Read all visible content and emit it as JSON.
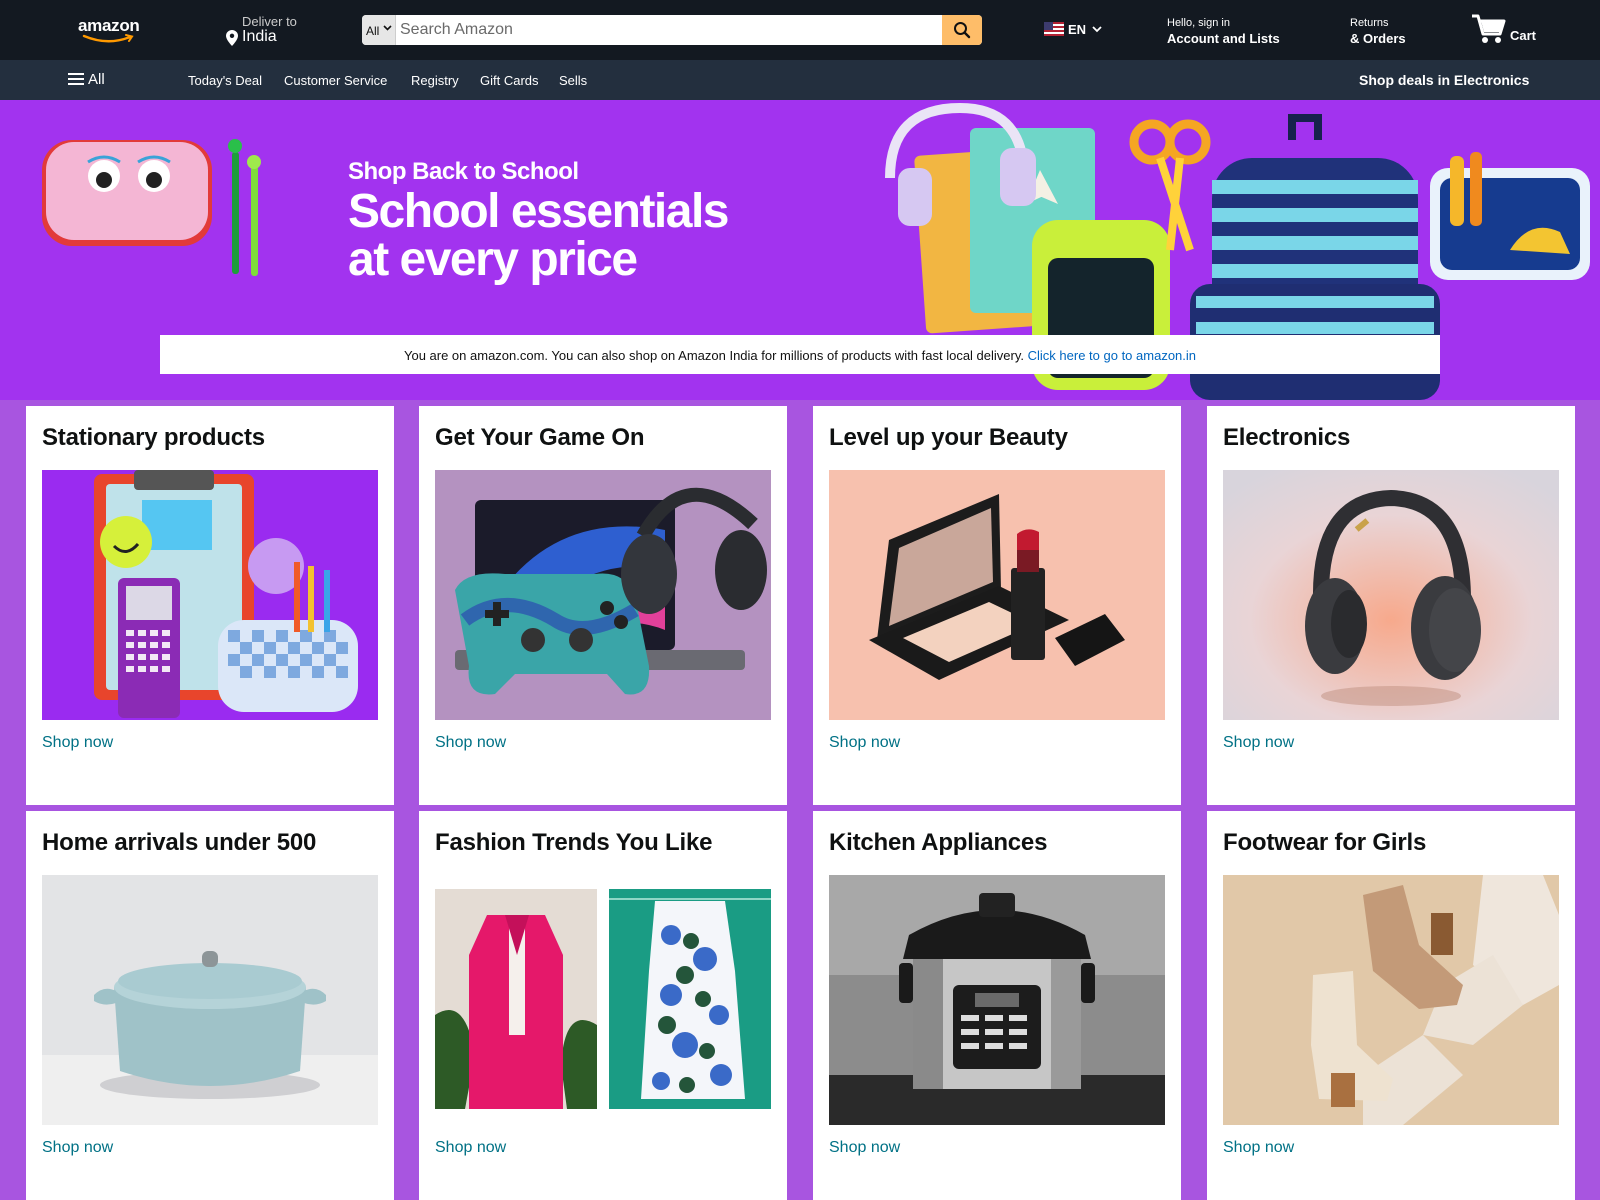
{
  "header": {
    "logo": "amazon",
    "deliver_label": "Deliver to",
    "deliver_location": "India",
    "search_category": "All",
    "search_placeholder": "Search Amazon",
    "language": "EN",
    "account_greeting": "Hello, sign in",
    "account_label": "Account and Lists",
    "returns_label": "Returns",
    "orders_label": "& Orders",
    "cart_label": "Cart"
  },
  "subnav": {
    "all_label": "All",
    "links": [
      "Today's Deal",
      "Customer Service",
      "Registry",
      "Gift Cards",
      "Sells"
    ],
    "promo": "Shop deals in Electronics"
  },
  "hero": {
    "kicker": "Shop Back to School",
    "title_line1": "School essentials",
    "title_line2": "at every price",
    "notice_text": "You are on amazon.com. You can also shop on Amazon India for millions of products with fast local delivery.",
    "notice_link": "Click here to go to amazon.in"
  },
  "cards": [
    {
      "title": "Stationary products",
      "link": "Shop now"
    },
    {
      "title": "Get Your Game On",
      "link": "Shop now"
    },
    {
      "title": "Level up your Beauty",
      "link": "Shop now"
    },
    {
      "title": "Electronics",
      "link": "Shop now"
    },
    {
      "title": "Home arrivals under 500",
      "link": "Shop now"
    },
    {
      "title": "Fashion Trends You Like",
      "link": "Shop now"
    },
    {
      "title": "Kitchen Appliances",
      "link": "Shop now"
    },
    {
      "title": "Footwear for Girls",
      "link": "Shop now"
    }
  ],
  "colors": {
    "nav_dark": "#131921",
    "nav_sub": "#232f3e",
    "hero_purple": "#a233ef",
    "page_bg": "#a855e0",
    "search_button": "#febd69",
    "link_teal": "#007185",
    "notice_link": "#0066c0"
  }
}
